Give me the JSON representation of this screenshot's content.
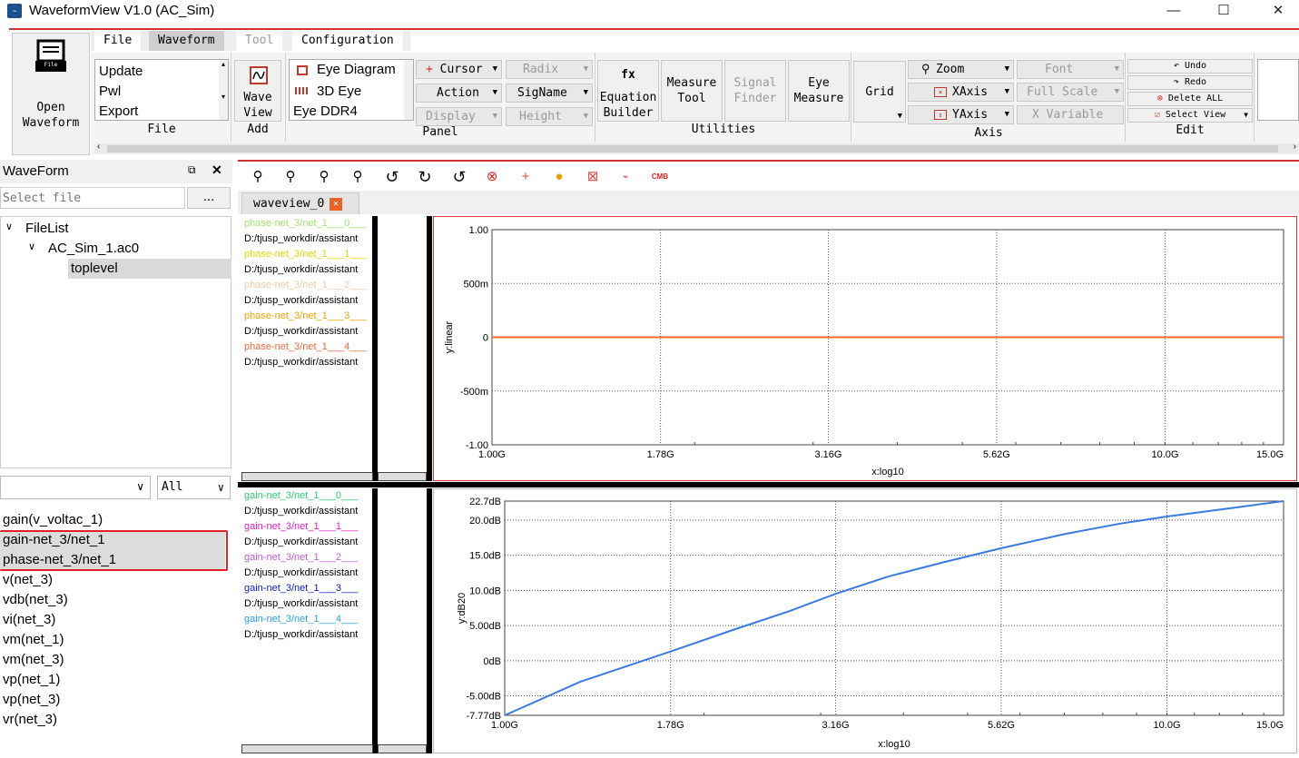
{
  "window": {
    "title": "WaveformView V1.0 (AC_Sim)",
    "minimize": "—",
    "maximize": "☐",
    "close": "✕"
  },
  "menu": {
    "file": "File",
    "waveform": "Waveform",
    "tool": "Tool",
    "configuration": "Configuration"
  },
  "open_waveform": {
    "line1": "Open",
    "line2": "Waveform",
    "icon_text": "File"
  },
  "ribbon": {
    "file_group": {
      "items": [
        "Update",
        "Pwl",
        "Export"
      ],
      "label": "File"
    },
    "add_group": {
      "wave_view_l1": "Wave",
      "wave_view_l2": "View",
      "label": "Add"
    },
    "panel_group": {
      "list": [
        "Eye Diagram",
        "3D Eye",
        "Eye DDR4"
      ],
      "cursor": "Cursor",
      "action": "Action",
      "display": "Display",
      "radix": "Radix",
      "signame": "SigName",
      "height": "Height",
      "label": "Panel"
    },
    "utilities_group": {
      "equation_icon": "fx",
      "equation_l1": "Equation",
      "equation_l2": "Builder",
      "measure_l1": "Measure",
      "measure_l2": "Tool",
      "signal_l1": "Signal",
      "signal_l2": "Finder",
      "eye_l1": "Eye",
      "eye_l2": "Measure",
      "label": "Utilities"
    },
    "axis_group": {
      "grid": "Grid",
      "zoom": "Zoom",
      "xaxis": "XAxis",
      "yaxis": "YAxis",
      "font": "Font",
      "full_scale": "Full Scale",
      "x_variable": "X Variable",
      "label": "Axis"
    },
    "edit_group": {
      "undo": "Undo",
      "redo": "Redo",
      "delete_all": "Delete ALL",
      "select_view": "Select View",
      "label": "Edit"
    }
  },
  "left_panel": {
    "title": "WaveForm",
    "select_file_placeholder": "Select file",
    "browse": "...",
    "tree": {
      "root": "FileList",
      "file": "AC_Sim_1.ac0",
      "child": "toplevel"
    },
    "filter_all": "All",
    "signals": [
      "gain(v_voltac_1)",
      "gain-net_3/net_1",
      "phase-net_3/net_1",
      "v(net_3)",
      "vdb(net_3)",
      "vi(net_3)",
      "vm(net_1)",
      "vm(net_3)",
      "vp(net_1)",
      "vp(net_3)",
      "vr(net_3)"
    ]
  },
  "tab": {
    "name": "waveview_0"
  },
  "panel1": {
    "entries": [
      {
        "name": "phase-net_3/net_1___0___",
        "path": "D:/tjusp_workdir/assistant",
        "color": "#9ee36a"
      },
      {
        "name": "phase-net_3/net_1___1___",
        "path": "D:/tjusp_workdir/assistant",
        "color": "#e6d400"
      },
      {
        "name": "phase-net_3/net_1___2___",
        "path": "D:/tjusp_workdir/assistant",
        "color": "#f2c8a8"
      },
      {
        "name": "phase-net_3/net_1___3___",
        "path": "D:/tjusp_workdir/assistant",
        "color": "#f0a000"
      },
      {
        "name": "phase-net_3/net_1___4___",
        "path": "D:/tjusp_workdir/assistant",
        "color": "#f06a3c"
      }
    ]
  },
  "panel2": {
    "entries": [
      {
        "name": "gain-net_3/net_1___0___",
        "path": "D:/tjusp_workdir/assistant",
        "color": "#2ecc71"
      },
      {
        "name": "gain-net_3/net_1___1___",
        "path": "D:/tjusp_workdir/assistant",
        "color": "#e020c8"
      },
      {
        "name": "gain-net_3/net_1___2___",
        "path": "D:/tjusp_workdir/assistant",
        "color": "#c05cd8"
      },
      {
        "name": "gain-net_3/net_1___3___",
        "path": "D:/tjusp_workdir/assistant",
        "color": "#1020c0"
      },
      {
        "name": "gain-net_3/net_1___4___",
        "path": "D:/tjusp_workdir/assistant",
        "color": "#2a9ee0"
      }
    ]
  },
  "chart_data": [
    {
      "type": "line",
      "ylabel": "y:linear",
      "xlabel": "x:log10",
      "x_scale": "log",
      "x_tick_labels": [
        "1.00G",
        "1.78G",
        "3.16G",
        "5.62G",
        "10.0G",
        "15.0G"
      ],
      "x_ticks": [
        1.0,
        1.78,
        3.16,
        5.62,
        10.0,
        15.0
      ],
      "y_tick_labels": [
        "1.00",
        "500m",
        "0",
        "-500m",
        "-1.00"
      ],
      "y_ticks": [
        1.0,
        0.5,
        0,
        -0.5,
        -1.0
      ],
      "ylim": [
        -1.0,
        1.0
      ],
      "grid": true,
      "series": [
        {
          "x": [
            1.0,
            15.0
          ],
          "y": [
            0,
            0
          ],
          "color": "#ff6a2a"
        }
      ]
    },
    {
      "type": "line",
      "ylabel": "y:dB20",
      "xlabel": "x:log10",
      "x_scale": "log",
      "x_tick_labels": [
        "1.00G",
        "1.78G",
        "3.16G",
        "5.62G",
        "10.0G",
        "15.0G"
      ],
      "x_ticks": [
        1.0,
        1.78,
        3.16,
        5.62,
        10.0,
        15.0
      ],
      "y_tick_labels": [
        "22.7dB",
        "20.0dB",
        "15.0dB",
        "10.0dB",
        "5.00dB",
        "0dB",
        "-5.00dB",
        "-7.77dB"
      ],
      "y_ticks": [
        22.7,
        20,
        15,
        10,
        5,
        0,
        -5,
        -7.77
      ],
      "ylim": [
        -7.77,
        22.7
      ],
      "grid": true,
      "series": [
        {
          "x": [
            1.0,
            1.3,
            1.78,
            2.2,
            2.7,
            3.16,
            3.8,
            4.6,
            5.62,
            7.0,
            8.5,
            10.0,
            12.5,
            15.0
          ],
          "y": [
            -7.77,
            -3.0,
            1.3,
            4.3,
            7.1,
            9.5,
            12.0,
            14.0,
            16.0,
            18.0,
            19.5,
            20.5,
            21.7,
            22.7
          ],
          "color": "#3a7be0"
        }
      ]
    }
  ]
}
